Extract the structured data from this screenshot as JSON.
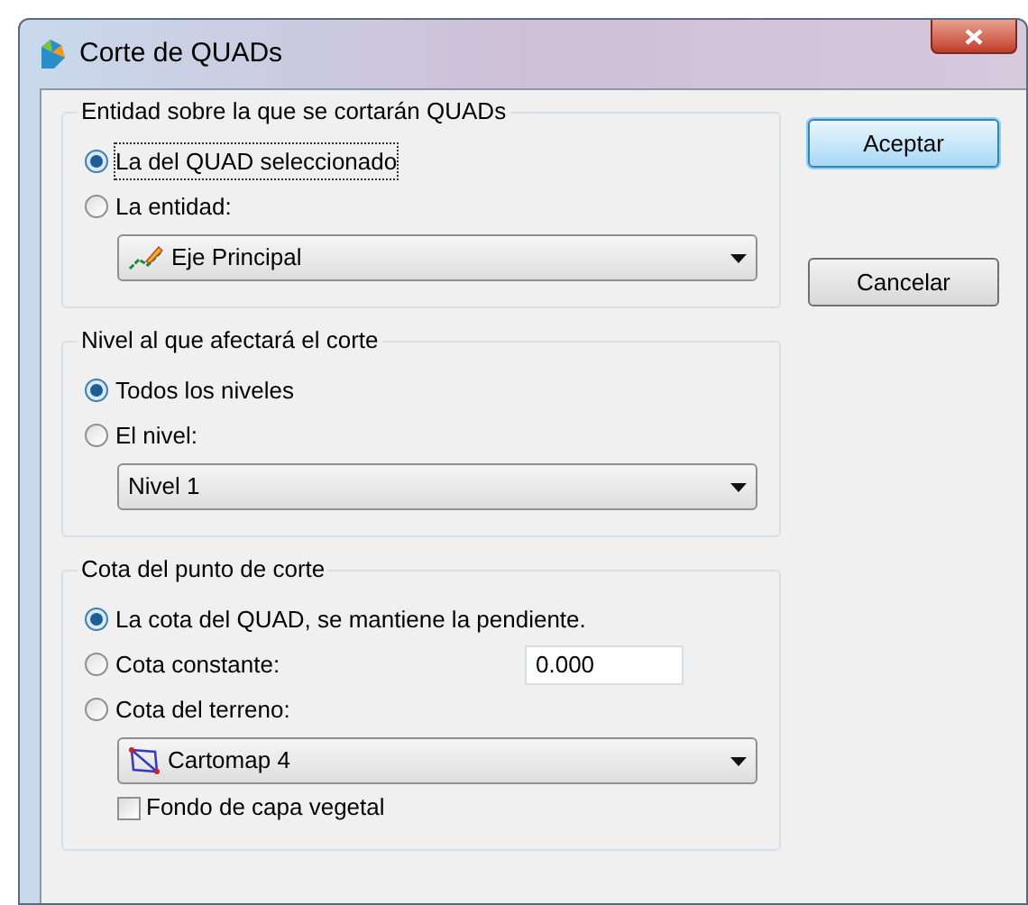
{
  "window": {
    "title": "Corte de QUADs"
  },
  "groups": [
    {
      "title": "Entidad sobre la que se cortarán QUADs",
      "items": [
        {
          "kind": "radio",
          "label": "La del QUAD seleccionado",
          "selected": true,
          "focused": true
        },
        {
          "kind": "radio",
          "label": "La entidad:",
          "selected": false,
          "focused": false
        },
        {
          "kind": "axis_select",
          "value": "Eje Principal"
        }
      ]
    },
    {
      "title": "Nivel al que afectará el corte",
      "items": [
        {
          "kind": "radio",
          "label": "Todos los niveles",
          "selected": true,
          "focused": false
        },
        {
          "kind": "radio",
          "label": "El nivel:",
          "selected": false,
          "focused": false
        },
        {
          "kind": "plain_select",
          "value": "Nivel 1"
        }
      ]
    },
    {
      "title": "Cota del punto de corte",
      "items": [
        {
          "kind": "radio",
          "label": "La cota del QUAD, se mantiene la pendiente.",
          "selected": true,
          "focused": false
        },
        {
          "kind": "radio_field",
          "label": "Cota constante:",
          "selected": false,
          "focused": false,
          "value": "0.000"
        },
        {
          "kind": "radio",
          "label": "Cota del terreno:",
          "selected": false,
          "focused": false
        },
        {
          "kind": "surface_select",
          "value": "Cartomap 4"
        },
        {
          "kind": "checkbox",
          "label": "Fondo de capa vegetal",
          "checked": false
        }
      ]
    }
  ],
  "buttons": [
    {
      "label": "Aceptar",
      "default": true
    },
    {
      "label": "Cancelar",
      "default": false
    }
  ]
}
